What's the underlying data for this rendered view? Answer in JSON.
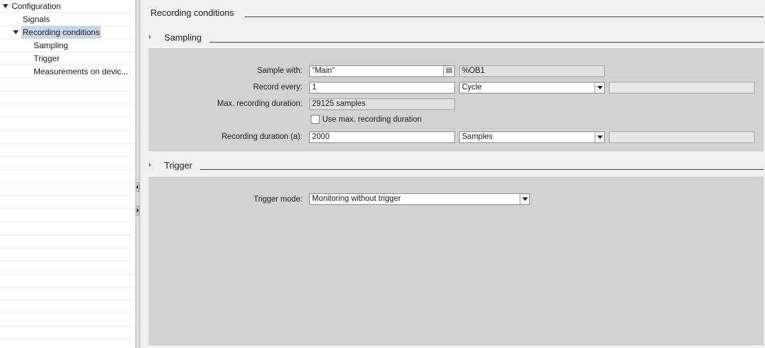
{
  "tree": {
    "items": [
      {
        "label": "Configuration",
        "expanded": true
      },
      {
        "label": "Signals"
      },
      {
        "label": "Recording conditions",
        "expanded": true,
        "selected": true
      },
      {
        "label": "Sampling"
      },
      {
        "label": "Trigger"
      },
      {
        "label": "Measurements on devic..."
      }
    ]
  },
  "header": {
    "title": "Recording conditions"
  },
  "sampling": {
    "title": "Sampling",
    "sample_with_label": "Sample with:",
    "sample_with_value": "\"Main\"",
    "sample_with_address": "%OB1",
    "record_every_label": "Record every:",
    "record_every_value": "1",
    "record_every_unit": "Cycle",
    "max_duration_label": "Max. recording duration:",
    "max_duration_value": "29125 samples",
    "use_max_label": "Use max. recording duration",
    "use_max_checked": false,
    "recording_duration_label": "Recording duration (a):",
    "recording_duration_value": "2000",
    "recording_duration_unit": "Samples"
  },
  "trigger": {
    "title": "Trigger",
    "mode_label": "Trigger mode:",
    "mode_value": "Monitoring without trigger"
  },
  "icons": {
    "collapse_arrow": "triangle-down-icon",
    "section_chevron": "chevron-right-icon",
    "browse": "list-browse-icon",
    "dropdown": "caret-down-icon"
  },
  "colors": {
    "selection": "#c6d7ea",
    "panel": "#d2d2d2",
    "background": "#f0f0f0"
  }
}
